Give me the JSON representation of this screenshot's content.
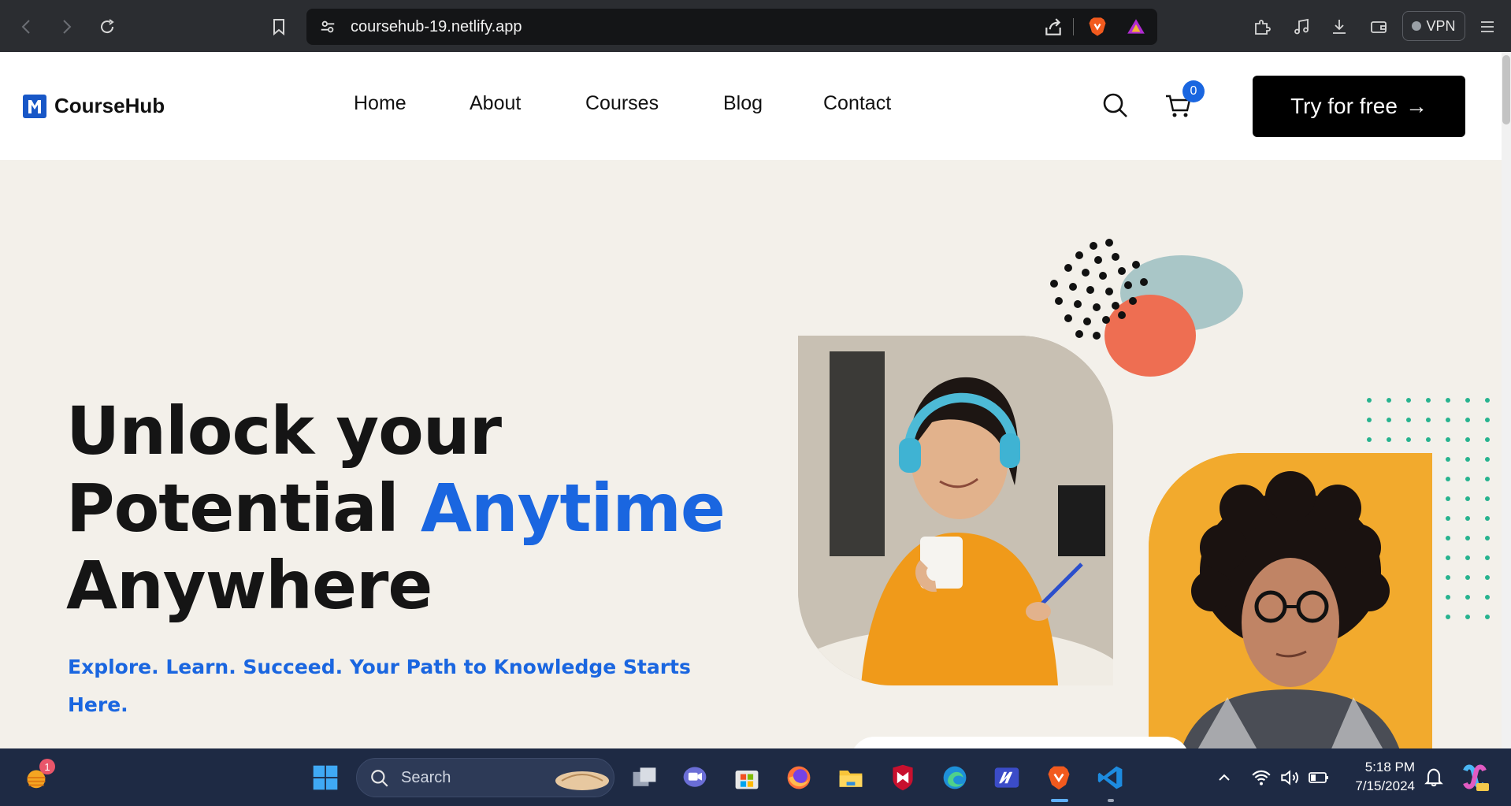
{
  "browser": {
    "url": "coursehub-19.netlify.app",
    "vpn_label": "VPN"
  },
  "site": {
    "logo_text": "CourseHub",
    "nav": [
      "Home",
      "About",
      "Courses",
      "Blog",
      "Contact"
    ],
    "cart_count": "0",
    "cta_label": "Try for free",
    "cta_arrow": "→"
  },
  "hero": {
    "title_line1": "Unlock your",
    "title_line2_plain": "Potential ",
    "title_line2_accent": "Anytime",
    "title_line3": "Anywhere",
    "subtitle": "Explore. Learn. Succeed. Your Path to Knowledge Starts Here."
  },
  "taskbar": {
    "search_label": "Search",
    "time": "5:18 PM",
    "date": "7/15/2024",
    "weather_badge": "1"
  },
  "colors": {
    "accent": "#1a66e0",
    "hero_bg": "#f3f0ea",
    "photo2_bg": "#f2aa2d",
    "blob_coral": "#ee6e52",
    "blob_teal": "#a9c6c7",
    "dots_green": "#27b38f"
  }
}
